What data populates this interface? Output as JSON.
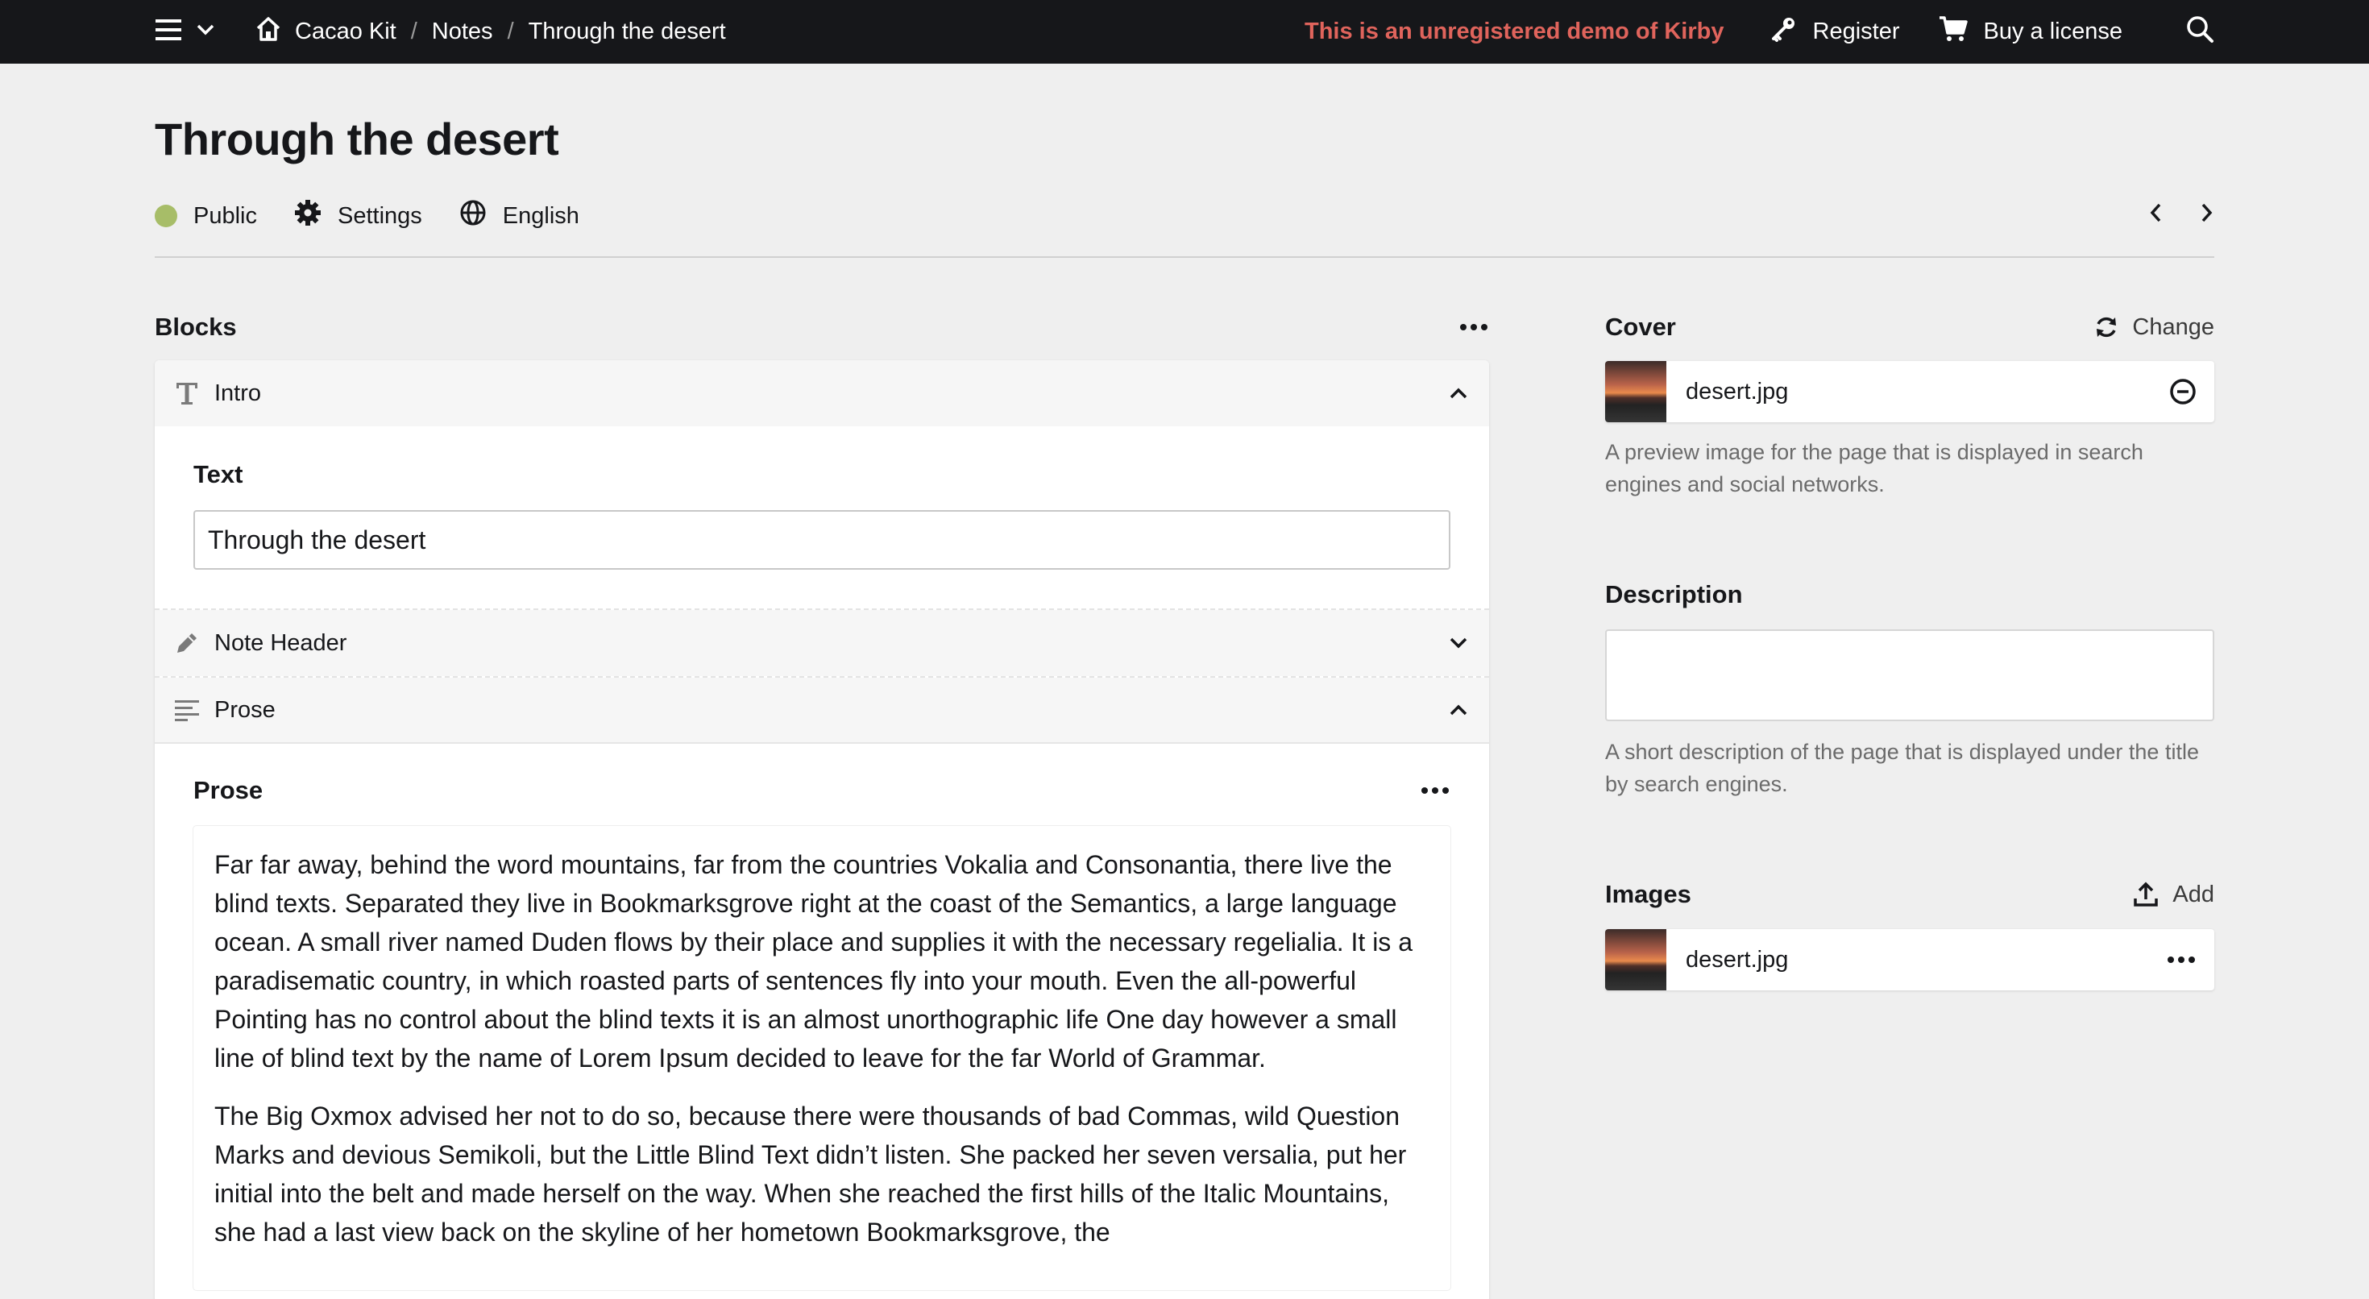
{
  "topbar": {
    "breadcrumbs": [
      "Cacao Kit",
      "Notes",
      "Through the desert"
    ],
    "demo_notice": "This is an unregistered demo of Kirby",
    "register_label": "Register",
    "buy_label": "Buy a license",
    "icons": [
      "menu-icon",
      "chevron-down-icon",
      "home-icon",
      "key-icon",
      "cart-icon",
      "search-icon"
    ]
  },
  "page": {
    "title": "Through the desert",
    "status_label": "Public",
    "status_color": "#a7bd68",
    "settings_label": "Settings",
    "language_label": "English"
  },
  "blocks": {
    "title": "Blocks",
    "items": [
      {
        "label": "Intro",
        "icon": "title-icon",
        "expanded": true,
        "field_label": "Text",
        "field_value": "Through the desert"
      },
      {
        "label": "Note Header",
        "icon": "pencil-icon",
        "expanded": false
      },
      {
        "label": "Prose",
        "icon": "text-lines-icon",
        "expanded": true,
        "field_label": "Prose",
        "paragraphs": [
          "Far far away, behind the word mountains, far from the countries Vokalia and Consonantia, there live the blind texts. Separated they live in Bookmarksgrove right at the coast of the Semantics, a large language ocean. A small river named Duden flows by their place and supplies it with the necessary regelialia. It is a paradisematic country, in which roasted parts of sentences fly into your mouth. Even the all-powerful Pointing has no control about the blind texts it is an almost unorthographic life One day however a small line of blind text by the name of Lorem Ipsum decided to leave for the far World of Grammar.",
          "The Big Oxmox advised her not to do so, because there were thousands of bad Commas, wild Question Marks and devious Semikoli, but the Little Blind Text didn’t listen. She packed her seven versalia, put her initial into the belt and made herself on the way. When she reached the first hills of the Italic Mountains, she had a last view back on the skyline of her hometown Bookmarksgrove, the"
        ]
      }
    ]
  },
  "sidebar": {
    "cover": {
      "title": "Cover",
      "action_label": "Change",
      "file": "desert.jpg",
      "help": "A preview image for the page that is displayed in search engines and social networks."
    },
    "description": {
      "title": "Description",
      "value": "",
      "help": "A short description of the page that is displayed under the title by search engines."
    },
    "images": {
      "title": "Images",
      "action_label": "Add",
      "files": [
        "desert.jpg"
      ]
    }
  }
}
